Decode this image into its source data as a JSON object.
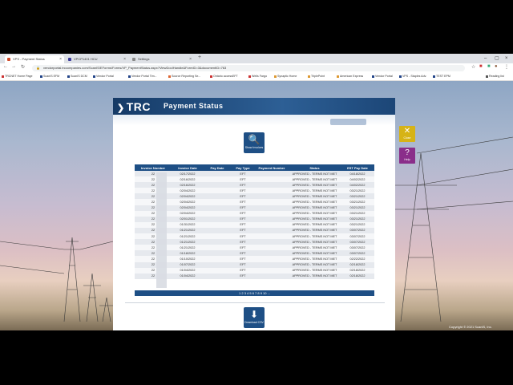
{
  "tabs": [
    {
      "label": "VPS - Payment Status",
      "color": "#d04a2a",
      "active": true
    },
    {
      "label": "VPCP1401 HCU",
      "color": "#3a3a9a",
      "active": false
    },
    {
      "label": "Settings",
      "color": "#888888",
      "active": false
    }
  ],
  "address": {
    "url": "vendorportal.trccompanies.com/ScanIS/EForms/Forms/VP_PaymentStatus.aspx?ViewDocIHandle&FormID=3&documentID=763"
  },
  "bookmarks": [
    "TRCNET Home Page",
    "ScanIS EFM",
    "ScanIS DCM",
    "Vendor Portal",
    "Vendor Portal Tim...",
    "Source Reporting Se...",
    "Ontario accessEFT",
    "Wells Fargo",
    "Synaptic Home",
    "TriplePoint",
    "American Express",
    "Vendor Portal",
    "VPS - Staples Adv.",
    "TEST EPM",
    "Reading list"
  ],
  "panel": {
    "logo": "TRC",
    "title": "Payment Status",
    "show_invoices_label": "Show Invoices",
    "download_label": "Download CSV",
    "close_label": "Close",
    "help_label": "Help"
  },
  "table": {
    "headers": [
      "Invoice Number",
      "Invoice Date",
      "Pay Date",
      "Pay Type",
      "Payment Number",
      "Status",
      "EST Pay Date"
    ],
    "rows": [
      [
        "22",
        "02/17/2022",
        "",
        "EFT",
        "",
        "APPROVED - TERMS NOT MET",
        "04/18/2022"
      ],
      [
        "22",
        "02/16/2022",
        "",
        "EFT",
        "",
        "APPROVED - TERMS NOT MET",
        "04/02/2022"
      ],
      [
        "22",
        "02/16/2022",
        "",
        "EFT",
        "",
        "APPROVED - TERMS NOT MET",
        "04/02/2022"
      ],
      [
        "22",
        "02/04/2022",
        "",
        "EFT",
        "",
        "APPROVED - TERMS NOT MET",
        "03/21/2022"
      ],
      [
        "22",
        "02/04/2022",
        "",
        "EFT",
        "",
        "APPROVED - TERMS NOT MET",
        "03/21/2022"
      ],
      [
        "22",
        "02/04/2022",
        "",
        "EFT",
        "",
        "APPROVED - TERMS NOT MET",
        "03/21/2022"
      ],
      [
        "22",
        "02/04/2022",
        "",
        "EFT",
        "",
        "APPROVED - TERMS NOT MET",
        "03/21/2022"
      ],
      [
        "22",
        "02/04/2022",
        "",
        "EFT",
        "",
        "APPROVED - TERMS NOT MET",
        "03/21/2022"
      ],
      [
        "22",
        "02/01/2022",
        "",
        "EFT",
        "",
        "APPROVED - TERMS NOT MET",
        "03/21/2022"
      ],
      [
        "22",
        "01/31/2022",
        "",
        "EFT",
        "",
        "APPROVED - TERMS NOT MET",
        "03/21/2022"
      ],
      [
        "22",
        "01/21/2022",
        "",
        "EFT",
        "",
        "APPROVED - TERMS NOT MET",
        "03/07/2022"
      ],
      [
        "22",
        "01/21/2022",
        "",
        "EFT",
        "",
        "APPROVED - TERMS NOT MET",
        "03/07/2022"
      ],
      [
        "22",
        "01/21/2022",
        "",
        "EFT",
        "",
        "APPROVED - TERMS NOT MET",
        "03/07/2022"
      ],
      [
        "22",
        "01/21/2022",
        "",
        "EFT",
        "",
        "APPROVED - TERMS NOT MET",
        "03/07/2022"
      ],
      [
        "22",
        "01/18/2022",
        "",
        "EFT",
        "",
        "APPROVED - TERMS NOT MET",
        "03/07/2022"
      ],
      [
        "22",
        "01/10/2022",
        "",
        "EFT",
        "",
        "APPROVED - TERMS NOT MET",
        "02/22/2022"
      ],
      [
        "22",
        "01/07/2022",
        "",
        "EFT",
        "",
        "APPROVED - TERMS NOT MET",
        "02/18/2022"
      ],
      [
        "22",
        "01/04/2022",
        "",
        "EFT",
        "",
        "APPROVED - TERMS NOT MET",
        "02/18/2022"
      ],
      [
        "22",
        "01/04/2022",
        "",
        "EFT",
        "",
        "APPROVED - TERMS NOT MET",
        "02/18/2022"
      ]
    ]
  },
  "pager": {
    "text": "1 2 3 4 5 6 7 8 9 10 ..."
  },
  "footer": {
    "copyright": "Copyright © 2021 ScanIS, Inc."
  },
  "colors": {
    "header": "#1e4f85",
    "close_btn": "#d6b316",
    "help_btn": "#8a2e8a"
  }
}
